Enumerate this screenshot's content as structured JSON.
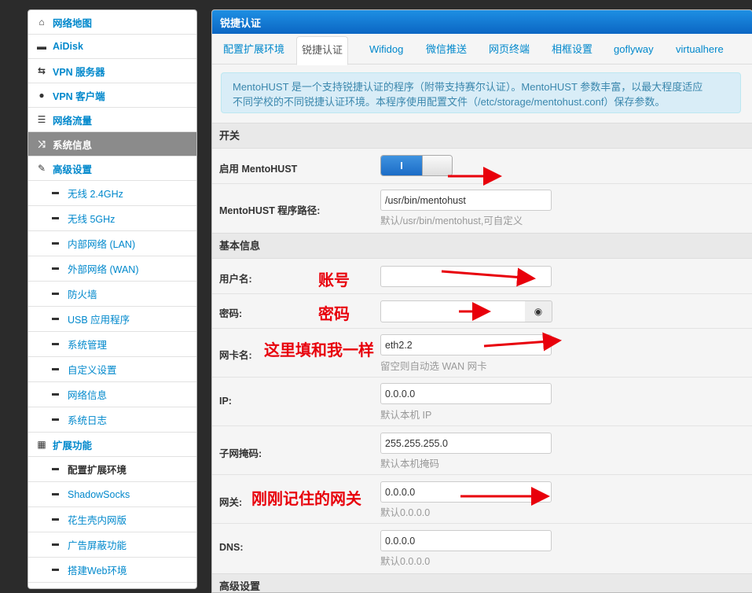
{
  "sidebar": {
    "items": [
      {
        "label": "网络地图",
        "icon": "home-icon",
        "glyph": "⌂"
      },
      {
        "label": "AiDisk",
        "icon": "hdd-icon",
        "glyph": "▬"
      },
      {
        "label": "VPN 服务器",
        "icon": "retweet-icon",
        "glyph": "⇆"
      },
      {
        "label": "VPN 客户端",
        "icon": "globe-icon",
        "glyph": "●"
      },
      {
        "label": "网络流量",
        "icon": "tasks-icon",
        "glyph": "☰"
      },
      {
        "label": "系统信息",
        "icon": "random-icon",
        "glyph": "⤨"
      },
      {
        "label": "高级设置",
        "icon": "wrench-icon",
        "glyph": "✎"
      }
    ],
    "sub_items": [
      "无线 2.4GHz",
      "无线 5GHz",
      "内部网络 (LAN)",
      "外部网络 (WAN)",
      "防火墙",
      "USB 应用程序",
      "系统管理",
      "自定义设置",
      "网络信息",
      "系统日志"
    ],
    "ext": {
      "label": "扩展功能",
      "icon": "grid-icon",
      "glyph": "▦"
    },
    "ext_items": [
      "配置扩展环境",
      "ShadowSocks",
      "花生壳内网版",
      "广告屏蔽功能",
      "搭建Web环境"
    ]
  },
  "panel": {
    "title": "锐捷认证",
    "tabs": [
      "配置扩展环境",
      "锐捷认证",
      "Wifidog",
      "微信推送",
      "网页终端",
      "相框设置",
      "goflyway",
      "virtualhere"
    ],
    "info_line1": "MentoHUST 是一个支持锐捷认证的程序（附带支持赛尔认证）。MentoHUST 参数丰富，以最大程度适应",
    "info_line2": "不同学校的不同锐捷认证环境。本程序使用配置文件（/etc/storage/mentohust.conf）保存参数。"
  },
  "sections": {
    "switch": "开关",
    "basic": "基本信息",
    "advanced": "高级设置"
  },
  "form": {
    "enable_label": "启用 MentoHUST",
    "toggle_on": "I",
    "path_label": "MentoHUST 程序路径:",
    "path_value": "/usr/bin/mentohust",
    "path_hint": "默认/usr/bin/mentohust,可自定义",
    "user_label": "用户名:",
    "user_value": "",
    "pass_label": "密码:",
    "pass_value": "",
    "nic_label": "网卡名:",
    "nic_value": "eth2.2",
    "nic_hint": "留空则自动选 WAN 网卡",
    "ip_label": "IP:",
    "ip_value": "0.0.0.0",
    "ip_hint": "默认本机 IP",
    "mask_label": "子网掩码:",
    "mask_value": "255.255.255.0",
    "mask_hint": "默认本机掩码",
    "gw_label": "网关:",
    "gw_value": "0.0.0.0",
    "gw_hint": "默认0.0.0.0",
    "dns_label": "DNS:",
    "dns_value": "0.0.0.0",
    "dns_hint": "默认0.0.0.0"
  },
  "annotations": {
    "account": "账号",
    "password": "密码",
    "nic": "这里填和我一样",
    "gateway": "刚刚记住的网关"
  },
  "colors": {
    "link": "#0088cc",
    "header": "#0b66c3",
    "annotation": "#e8000b",
    "info_bg": "#d9edf7"
  }
}
